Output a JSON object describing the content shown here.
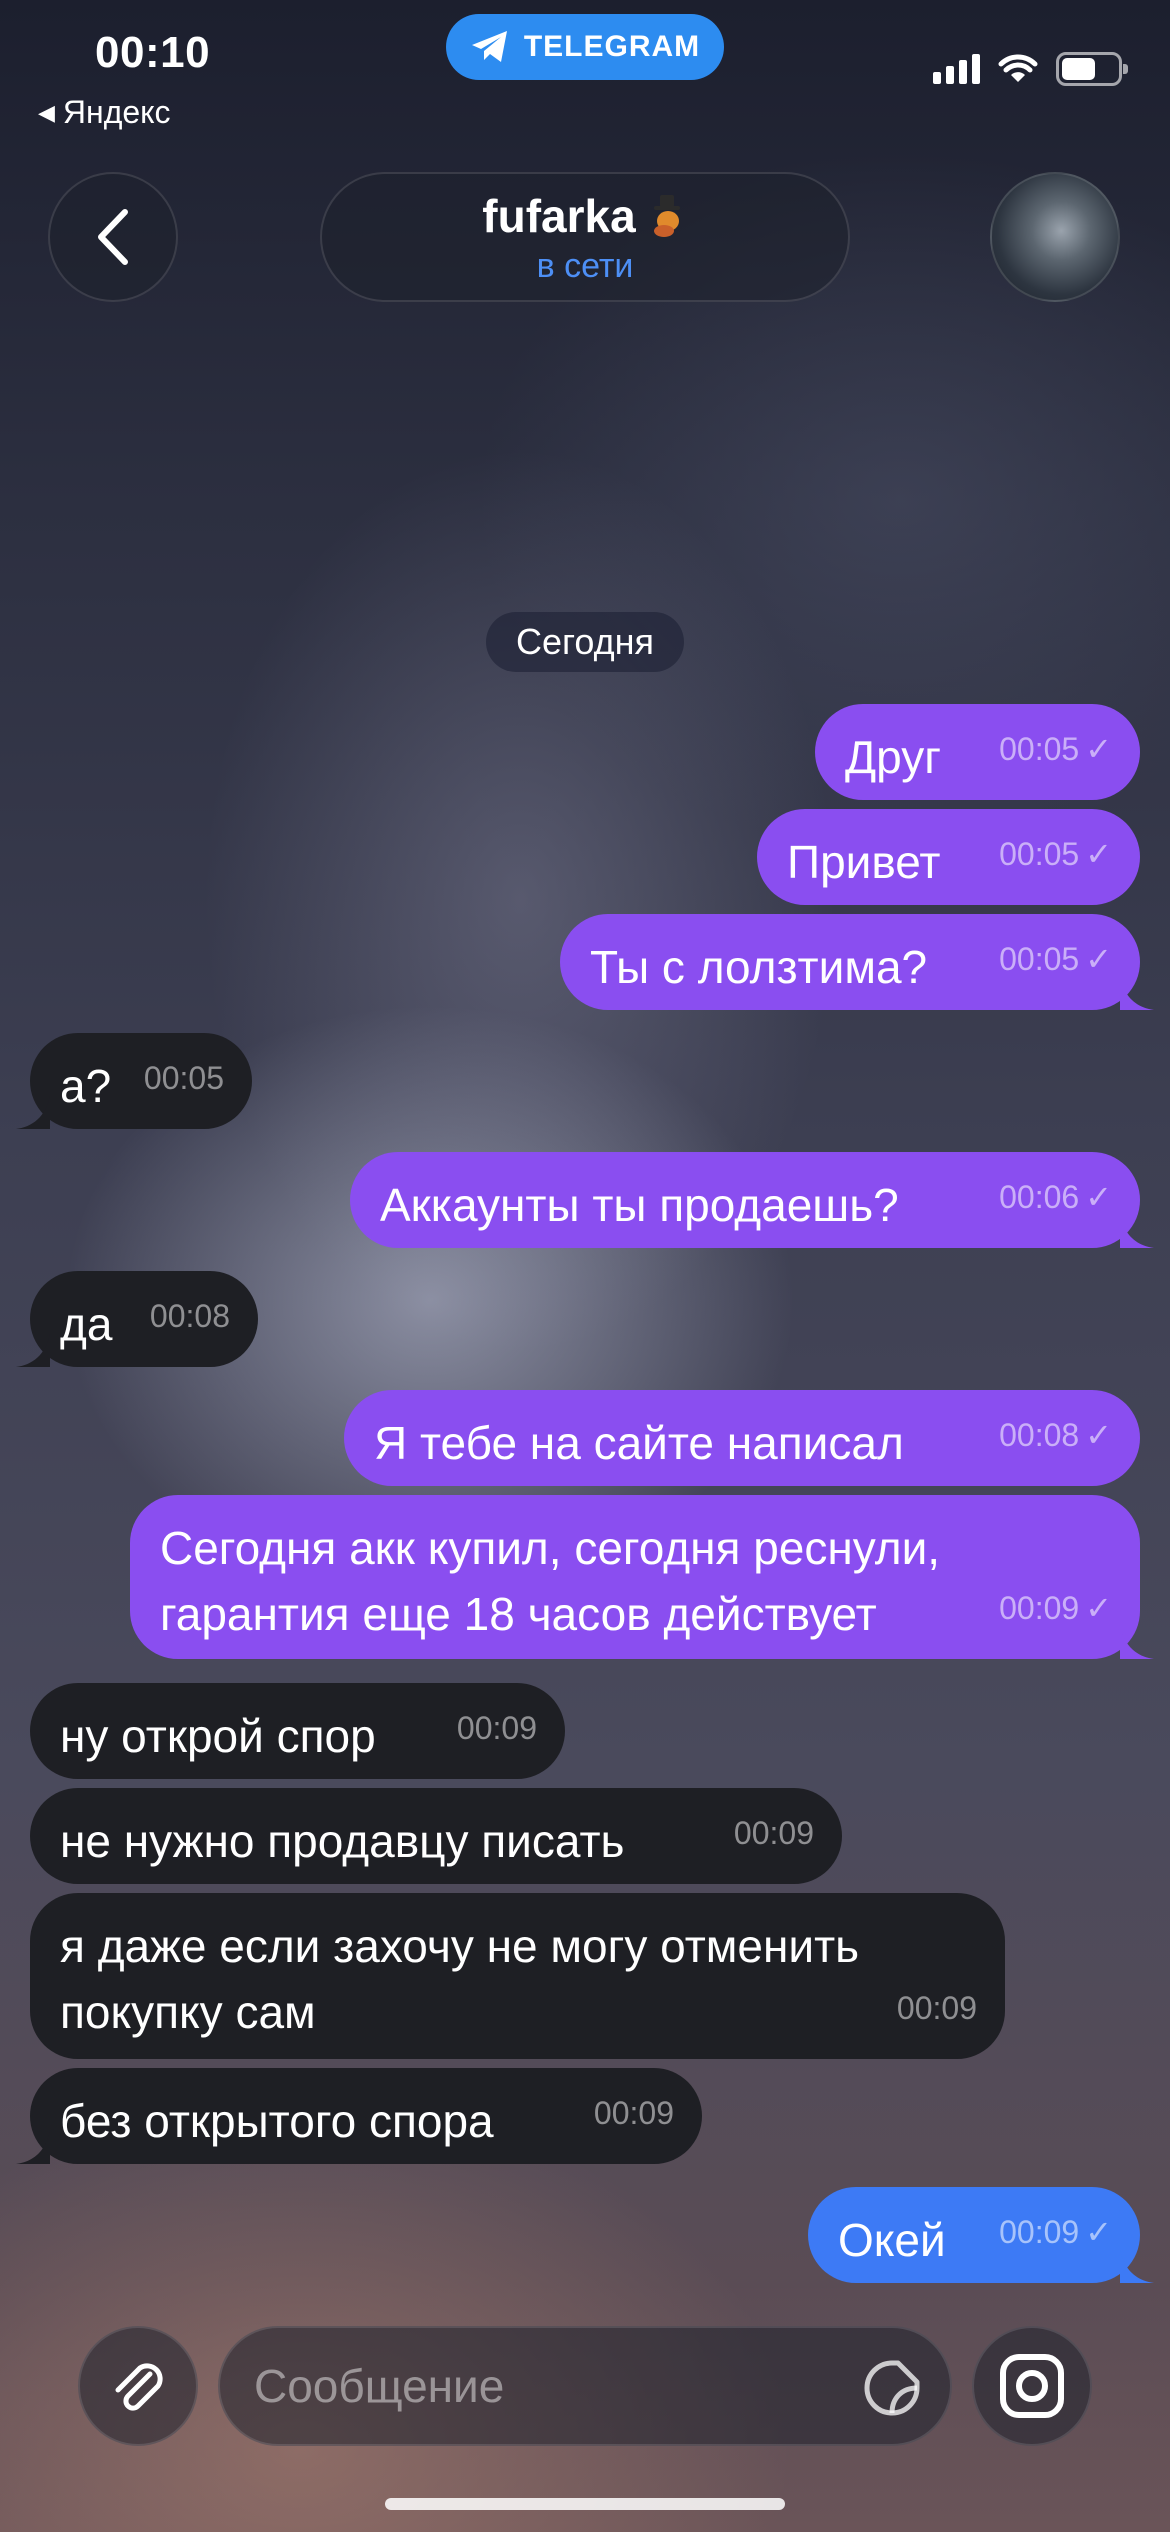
{
  "status_bar": {
    "time": "00:10",
    "back_app": "Яндекс",
    "telegram_label": "TELEGRAM"
  },
  "header": {
    "title": "fufarka",
    "status": "в сети",
    "avatar_icon": "avatar"
  },
  "date_chip": "Сегодня",
  "messages": [
    {
      "dir": "out",
      "text": "Друг",
      "time": "00:05"
    },
    {
      "dir": "out",
      "text": "Привет",
      "time": "00:05"
    },
    {
      "dir": "out",
      "text": "Ты с лолзтима?",
      "time": "00:05"
    },
    {
      "dir": "in",
      "text": "а?",
      "time": "00:05"
    },
    {
      "dir": "out",
      "text": "Аккаунты ты продаешь?",
      "time": "00:06"
    },
    {
      "dir": "in",
      "text": "да",
      "time": "00:08"
    },
    {
      "dir": "out",
      "text": "Я тебе на сайте написал",
      "time": "00:08"
    },
    {
      "dir": "out",
      "text": "Сегодня акк купил, сегодня реснули,",
      "text2": "гарантия еще 18 часов действует",
      "time": "00:09"
    },
    {
      "dir": "in",
      "text": "ну открой спор",
      "time": "00:09"
    },
    {
      "dir": "in",
      "text": "не нужно продавцу писать",
      "time": "00:09"
    },
    {
      "dir": "in",
      "text": "я даже если захочу не могу отменить",
      "text2": "покупку сам",
      "time": "00:09"
    },
    {
      "dir": "in",
      "text": "без открытого спора",
      "time": "00:09"
    },
    {
      "dir": "out",
      "text": "Окей",
      "time": "00:09"
    }
  ],
  "composer": {
    "placeholder": "Сообщение"
  },
  "colors": {
    "outgoing": "#8a4ef0",
    "outgoing_last": "#3d7af5",
    "incoming": "#1e1f24",
    "telegram_blue": "#2d8cf0",
    "online_status": "#4d8ff5"
  }
}
